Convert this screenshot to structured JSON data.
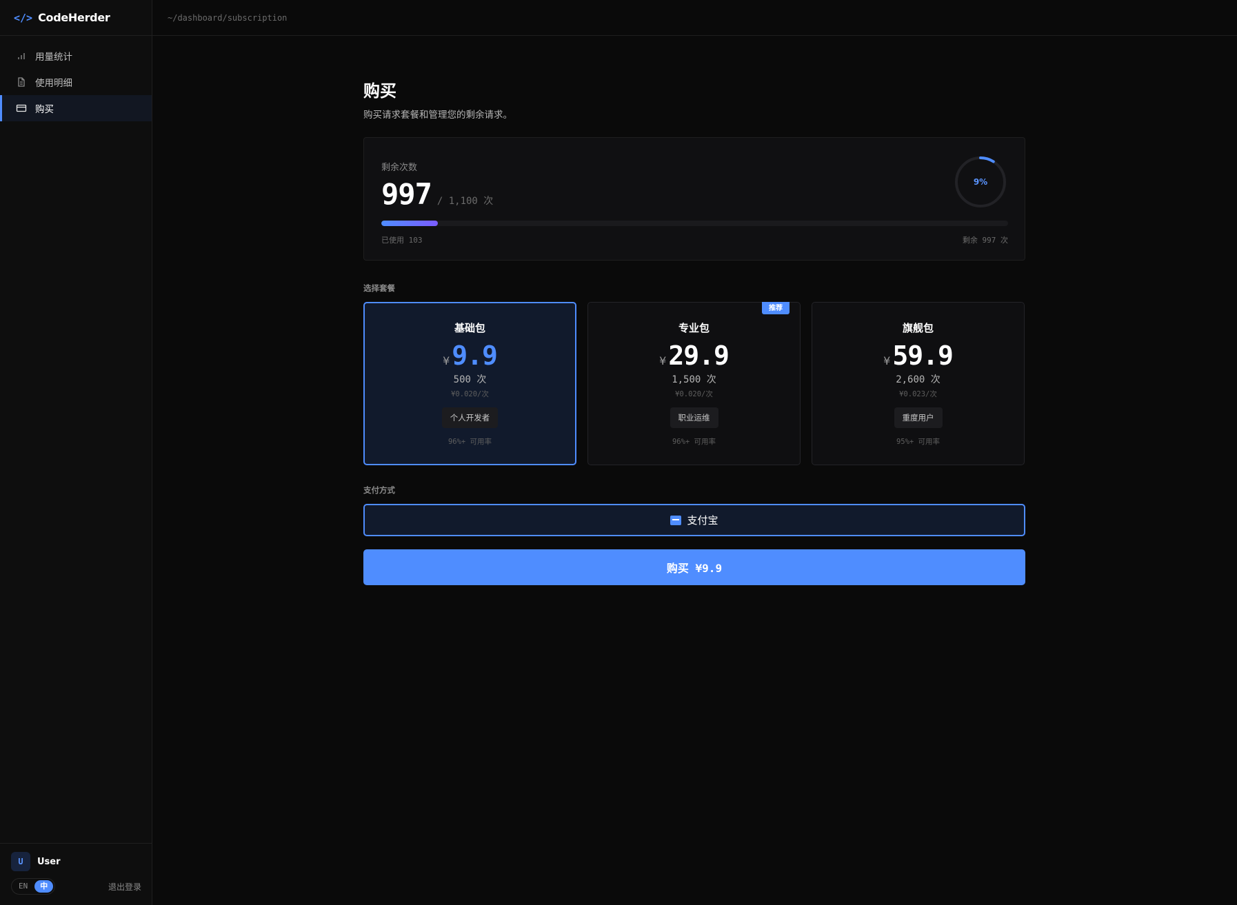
{
  "brand": {
    "icon": "</>",
    "name": "CodeHerder"
  },
  "topbar": {
    "path": "~/dashboard/subscription"
  },
  "sidebar": {
    "items": [
      {
        "label": "用量统计",
        "icon": "bar-chart-icon",
        "active": false
      },
      {
        "label": "使用明细",
        "icon": "document-icon",
        "active": false
      },
      {
        "label": "购买",
        "icon": "credit-card-icon",
        "active": true
      }
    ],
    "user": {
      "initial": "U",
      "name": "User"
    },
    "lang": {
      "en": "EN",
      "zh": "中",
      "active": "zh"
    },
    "logout": "退出登录"
  },
  "page": {
    "title": "购买",
    "subtitle": "购买请求套餐和管理您的剩余请求。"
  },
  "quota": {
    "label": "剩余次数",
    "remaining": "997",
    "total_text": "/ 1,100 次",
    "used_text": "已使用 103",
    "remain_text": "剩余 997 次",
    "used_fraction": 0.09,
    "percent_text": "9%"
  },
  "plans_section": {
    "label": "选择套餐"
  },
  "plans": [
    {
      "name": "基础包",
      "currency": "¥",
      "price": "9.9",
      "count": "500 次",
      "unit_price": "¥0.020/次",
      "tag": "个人开发者",
      "availability": "96%+ 可用率",
      "badge": "",
      "selected": true
    },
    {
      "name": "专业包",
      "currency": "¥",
      "price": "29.9",
      "count": "1,500 次",
      "unit_price": "¥0.020/次",
      "tag": "职业运维",
      "availability": "96%+ 可用率",
      "badge": "推荐",
      "selected": false
    },
    {
      "name": "旗舰包",
      "currency": "¥",
      "price": "59.9",
      "count": "2,600 次",
      "unit_price": "¥0.023/次",
      "tag": "重度用户",
      "availability": "95%+ 可用率",
      "badge": "",
      "selected": false
    }
  ],
  "payment": {
    "label": "支付方式",
    "method": "支付宝",
    "icon": "alipay-icon"
  },
  "buy_button": {
    "label": "购买 ¥9.9"
  },
  "colors": {
    "accent": "#4f8dff",
    "accent2": "#7b5cff",
    "background": "#0a0a0a"
  }
}
